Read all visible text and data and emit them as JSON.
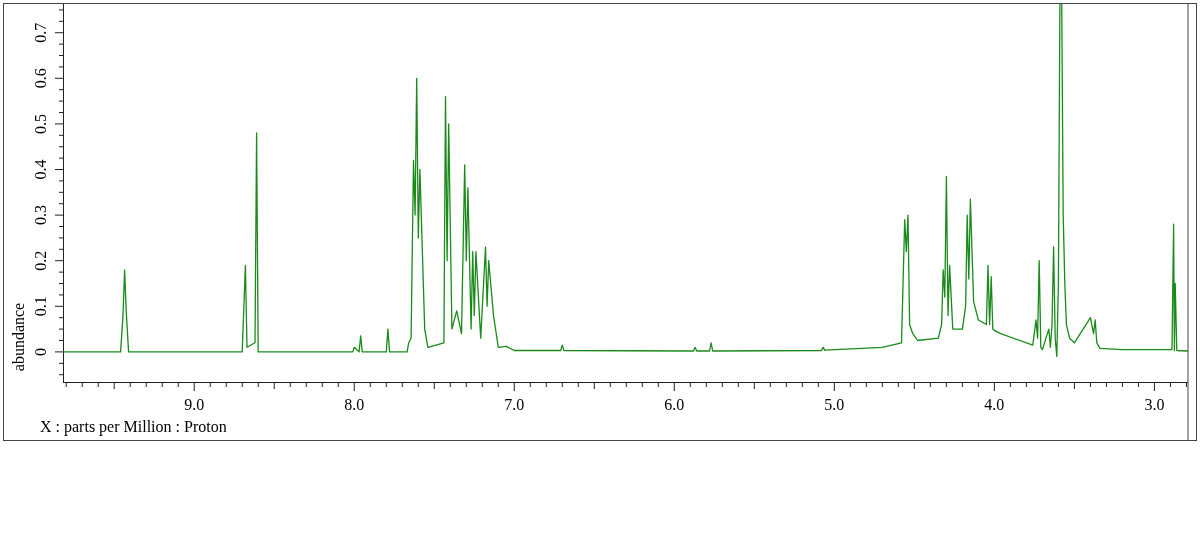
{
  "plot": {
    "chart_data": {
      "type": "line",
      "xlabel": "X : parts per Million : Proton",
      "ylabel": "abundance",
      "xlim": [
        9.82,
        2.79
      ],
      "ylim": [
        -0.066,
        0.763
      ],
      "xticks": [
        {
          "value": 9,
          "label": "9.0"
        },
        {
          "value": 8,
          "label": "8.0"
        },
        {
          "value": 7,
          "label": "7.0"
        },
        {
          "value": 6,
          "label": "6.0"
        },
        {
          "value": 5,
          "label": "5.0"
        },
        {
          "value": 4,
          "label": "4.0"
        },
        {
          "value": 3,
          "label": "3.0"
        }
      ],
      "yticks": [
        0,
        0.1,
        0.2,
        0.3,
        0.4,
        0.5,
        0.6,
        0.7
      ],
      "x": [
        9.82,
        9.46,
        9.445,
        9.435,
        9.425,
        9.41,
        8.7,
        8.68,
        8.67,
        8.62,
        8.61,
        8.6,
        8.01,
        8.0,
        7.97,
        7.96,
        7.95,
        7.8,
        7.79,
        7.78,
        7.67,
        7.66,
        7.645,
        7.63,
        7.62,
        7.61,
        7.6,
        7.59,
        7.56,
        7.54,
        7.44,
        7.43,
        7.42,
        7.41,
        7.39,
        7.36,
        7.33,
        7.31,
        7.3,
        7.29,
        7.27,
        7.26,
        7.25,
        7.24,
        7.21,
        7.18,
        7.17,
        7.16,
        7.13,
        7.1,
        7.05,
        7.0,
        6.71,
        6.7,
        6.69,
        5.88,
        5.87,
        5.86,
        5.78,
        5.77,
        5.76,
        5.08,
        5.07,
        5.06,
        4.7,
        4.58,
        4.56,
        4.55,
        4.54,
        4.53,
        4.51,
        4.48,
        4.35,
        4.33,
        4.32,
        4.31,
        4.3,
        4.29,
        4.28,
        4.26,
        4.2,
        4.18,
        4.17,
        4.16,
        4.15,
        4.13,
        4.1,
        4.05,
        4.04,
        4.03,
        4.02,
        4.01,
        3.99,
        3.96,
        3.76,
        3.74,
        3.73,
        3.72,
        3.71,
        3.7,
        3.66,
        3.65,
        3.64,
        3.63,
        3.62,
        3.61,
        3.6,
        3.59,
        3.58,
        3.57,
        3.56,
        3.55,
        3.53,
        3.5,
        3.4,
        3.38,
        3.37,
        3.36,
        3.34,
        3.2,
        2.89,
        2.88,
        2.875,
        2.87,
        2.86,
        2.79
      ],
      "series": [
        {
          "color": "#1a8a1a",
          "values": [
            0,
            0,
            0.08,
            0.18,
            0.09,
            0,
            0,
            0.19,
            0.01,
            0.02,
            0.48,
            0,
            0,
            0.01,
            0,
            0.035,
            0,
            0,
            0.05,
            0,
            0,
            0.02,
            0.03,
            0.42,
            0.3,
            0.6,
            0.25,
            0.4,
            0.05,
            0.01,
            0.02,
            0.56,
            0.2,
            0.5,
            0.05,
            0.09,
            0.04,
            0.41,
            0.2,
            0.36,
            0.05,
            0.22,
            0.08,
            0.22,
            0.03,
            0.23,
            0.1,
            0.2,
            0.08,
            0.01,
            0.012,
            0.003,
            0.003,
            0.015,
            0.003,
            0.002,
            0.01,
            0.002,
            0.002,
            0.02,
            0.002,
            0.003,
            0.01,
            0.004,
            0.01,
            0.02,
            0.29,
            0.22,
            0.3,
            0.06,
            0.04,
            0.025,
            0.03,
            0.06,
            0.18,
            0.12,
            0.385,
            0.08,
            0.19,
            0.05,
            0.05,
            0.1,
            0.3,
            0.16,
            0.335,
            0.11,
            0.07,
            0.06,
            0.19,
            0.06,
            0.165,
            0.05,
            0.045,
            0.04,
            0.015,
            0.07,
            0.03,
            0.2,
            0.01,
            0.005,
            0.05,
            0.01,
            0.06,
            0.23,
            0.03,
            -0.01,
            0.15,
            null,
            null,
            0.3,
            0.15,
            0.06,
            0.03,
            0.02,
            0.075,
            0.04,
            0.07,
            0.02,
            0.008,
            0.005,
            0.005,
            0.28,
            0.003,
            0.15,
            0.003,
            0.002
          ]
        }
      ]
    }
  }
}
